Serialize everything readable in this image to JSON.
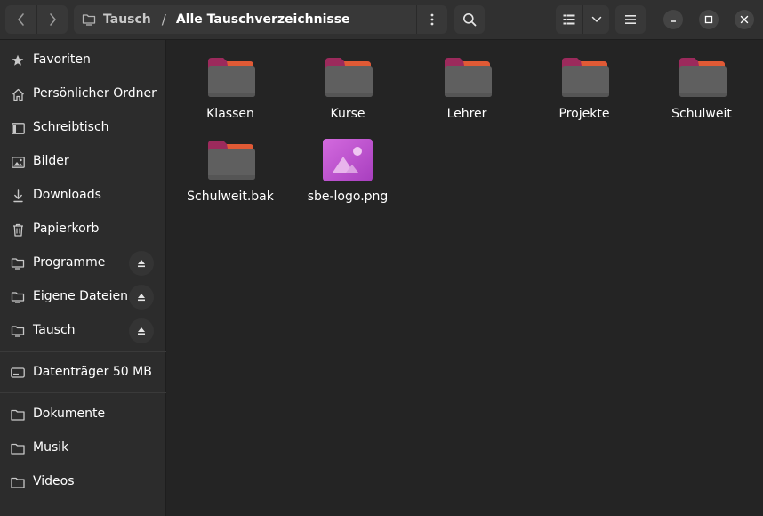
{
  "header": {
    "back_icon": "chevron-left-icon",
    "forward_icon": "chevron-right-icon",
    "path": {
      "home_label": "Tausch",
      "separator": "/",
      "current": "Alle Tauschverzeichnisse"
    },
    "search_icon": "search-icon",
    "view_list_icon": "list-view-icon",
    "view_options_icon": "chevron-down-icon",
    "menu_icon": "hamburger-menu-icon",
    "window_controls": [
      "minimize-icon",
      "maximize-icon",
      "close-icon"
    ]
  },
  "sidebar": {
    "items": [
      {
        "label": "Favoriten",
        "icon": "star-icon",
        "eject": false
      },
      {
        "label": "Persönlicher Ordner",
        "icon": "home-icon",
        "eject": false
      },
      {
        "label": "Schreibtisch",
        "icon": "desktop-icon",
        "eject": false
      },
      {
        "label": "Bilder",
        "icon": "pictures-icon",
        "eject": false
      },
      {
        "label": "Downloads",
        "icon": "download-icon",
        "eject": false
      },
      {
        "label": "Papierkorb",
        "icon": "trash-icon",
        "eject": false
      },
      {
        "label": "Programme",
        "icon": "network-folder-icon",
        "eject": true
      },
      {
        "label": "Eigene Dateien",
        "icon": "network-folder-icon",
        "eject": true
      },
      {
        "label": "Tausch",
        "icon": "network-folder-icon",
        "eject": true
      },
      {
        "label": "Datenträger 50 MB",
        "icon": "drive-icon",
        "eject": false
      },
      {
        "label": "Dokumente",
        "icon": "folder-icon",
        "eject": false
      },
      {
        "label": "Musik",
        "icon": "folder-icon",
        "eject": false
      },
      {
        "label": "Videos",
        "icon": "folder-icon",
        "eject": false
      }
    ]
  },
  "files": [
    {
      "name": "Klassen",
      "type": "folder"
    },
    {
      "name": "Kurse",
      "type": "folder"
    },
    {
      "name": "Lehrer",
      "type": "folder"
    },
    {
      "name": "Projekte",
      "type": "folder"
    },
    {
      "name": "Schulweit",
      "type": "folder"
    },
    {
      "name": "Schulweit.bak",
      "type": "folder"
    },
    {
      "name": "sbe-logo.png",
      "type": "image"
    }
  ],
  "colors": {
    "folder_body": "#5e5e5e",
    "folder_tab": "#b12f6a",
    "folder_accent": "#e9632e",
    "image_icon": "#c25ad2",
    "window_bg": "#242424",
    "sidebar_bg": "#2c2c2c"
  }
}
